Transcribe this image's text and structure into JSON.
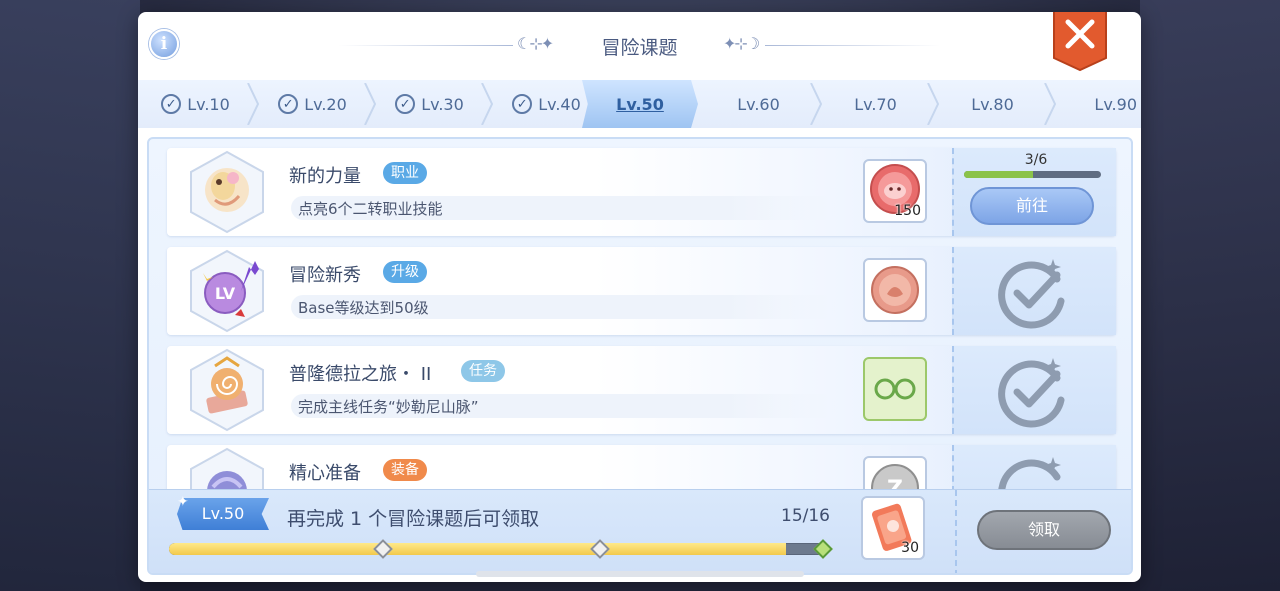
{
  "header": {
    "title": "冒险课题",
    "info_icon": "info-icon",
    "info_glyph": "i",
    "close_icon": "close-icon",
    "ornament_left": "☾⊹✦",
    "ornament_right": "✦⊹☽"
  },
  "tabs": [
    {
      "label": "Lv.10",
      "completed": true
    },
    {
      "label": "Lv.20",
      "completed": true
    },
    {
      "label": "Lv.30",
      "completed": true
    },
    {
      "label": "Lv.40",
      "completed": true
    },
    {
      "label": "Lv.50",
      "completed": false,
      "active": true
    },
    {
      "label": "Lv.60",
      "completed": false
    },
    {
      "label": "Lv.70",
      "completed": false
    },
    {
      "label": "Lv.80",
      "completed": false
    },
    {
      "label": "Lv.90",
      "completed": false
    }
  ],
  "check_glyph": "✓",
  "quests": [
    {
      "title": "新的力量",
      "tag": "职业",
      "tag_color": "#5aa9e6",
      "description": "点亮6个二转职业技能",
      "reward_count": "150",
      "reward_icon": "poring-coin-icon",
      "progress": "3/6",
      "progress_fraction": 0.5,
      "action": "前往",
      "status": "in-progress"
    },
    {
      "title": "冒险新秀",
      "tag": "升级",
      "tag_color": "#5aa9e6",
      "description": "Base等级达到50级",
      "reward_icon": "medal-icon",
      "status": "completed"
    },
    {
      "title": "普隆德拉之旅・ II",
      "tag": "任务",
      "tag_color": "#8ec7e8",
      "description": "完成主线任务“妙勒尼山脉”",
      "reward_icon": "glasses-icon",
      "status": "completed"
    },
    {
      "title": "精心准备",
      "tag": "装备",
      "tag_color": "#f08a4b",
      "reward_icon": "zeny-coin-icon",
      "status": "completed"
    }
  ],
  "bottom": {
    "level_label": "Lv.50",
    "message": "再完成 1 个冒险课题后可领取",
    "count": "15/16",
    "progress_fraction": 0.94,
    "milestones": [
      0.33,
      0.66,
      1.0
    ],
    "reward_count": "30",
    "reward_icon": "ticket-icon",
    "claim_label": "领取",
    "star_glyph": "✦"
  },
  "colors": {
    "accent": "#7da4e6",
    "close": "#e0542a",
    "progress_green": "#8bc34a",
    "track_yellow": "#f2c94c"
  }
}
